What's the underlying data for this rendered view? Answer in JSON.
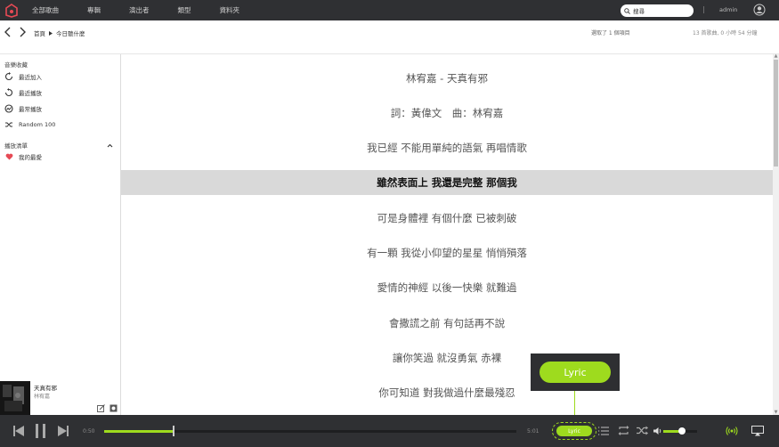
{
  "nav": {
    "items": [
      "全部歌曲",
      "專輯",
      "演出者",
      "類型",
      "資料夾"
    ]
  },
  "search": {
    "value": "搜尋"
  },
  "header": {
    "separator": "|",
    "user": "admin"
  },
  "breadcrumb": {
    "root": "首頁",
    "current": "今日聽什麼"
  },
  "status": {
    "selected": "選取了 1 個項目",
    "summary": "13 首歌曲, 0 小時 54 分鐘"
  },
  "sidebar": {
    "library_title": "音樂收藏",
    "items": [
      {
        "label": "最近加入",
        "icon": "recently-added-icon"
      },
      {
        "label": "最近播放",
        "icon": "recently-played-icon"
      },
      {
        "label": "最常播放",
        "icon": "most-played-icon"
      },
      {
        "label": "Random 100",
        "icon": "shuffle-icon"
      }
    ],
    "playlist_title": "播放清單",
    "playlists": [
      {
        "label": "我的最愛",
        "icon": "heart-icon"
      }
    ]
  },
  "now_playing": {
    "title": "天真有邪",
    "artist": "林宥嘉"
  },
  "lyrics": {
    "active_index": 3,
    "lines": [
      "林宥嘉 - 天真有邪",
      "詞：黃偉文　曲：林宥嘉",
      "我已經 不能用單純的語氣 再唱情歌",
      "雖然表面上 我還是完整 那個我",
      "可是身體裡 有個什麼 已被刺破",
      "有一顆 我從小仰望的星星 悄悄殞落",
      "愛情的神經 以後一快樂 就難過",
      "會撒謊之前 有句話再不說",
      "讓你笑過 就沒勇氣 赤裸",
      "你可知道 對我做過什麼最殘忍"
    ]
  },
  "callout": {
    "label": "Lyric"
  },
  "player": {
    "elapsed": "0:50",
    "duration": "5:01",
    "progress": 0.166,
    "lyric_label": "Lyric",
    "volume": 0.55
  },
  "colors": {
    "accent": "#9edb1e",
    "topbar": "#2f3033",
    "active_line": "#d9d9d9"
  }
}
